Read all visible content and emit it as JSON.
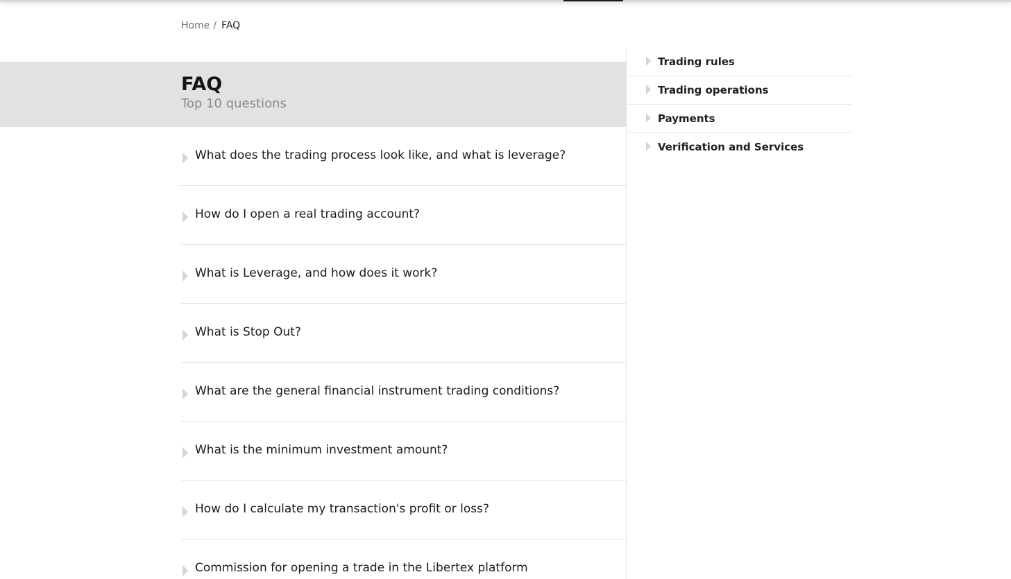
{
  "breadcrumb": {
    "home": "Home",
    "separator": "/",
    "current": "FAQ"
  },
  "hero": {
    "title": "FAQ",
    "subtitle": "Top 10 questions"
  },
  "faq": {
    "questions": [
      "What does the trading process look like, and what is leverage?",
      "How do I open a real trading account?",
      "What is Leverage, and how does it work?",
      "What is Stop Out?",
      "What are the general financial instrument trading conditions?",
      "What is the minimum investment amount?",
      "How do I calculate my transaction's profit or loss?",
      "Commission for opening a trade in the Libertex platform"
    ]
  },
  "sidebar": {
    "categories": [
      "Trading rules",
      "Trading operations",
      "Payments",
      "Verification and Services"
    ]
  },
  "colors": {
    "hero_background": "#e1e2e3",
    "caret": "#d5d5d5",
    "divider": "#e4e4e4",
    "muted_text": "#8a8a8a"
  }
}
